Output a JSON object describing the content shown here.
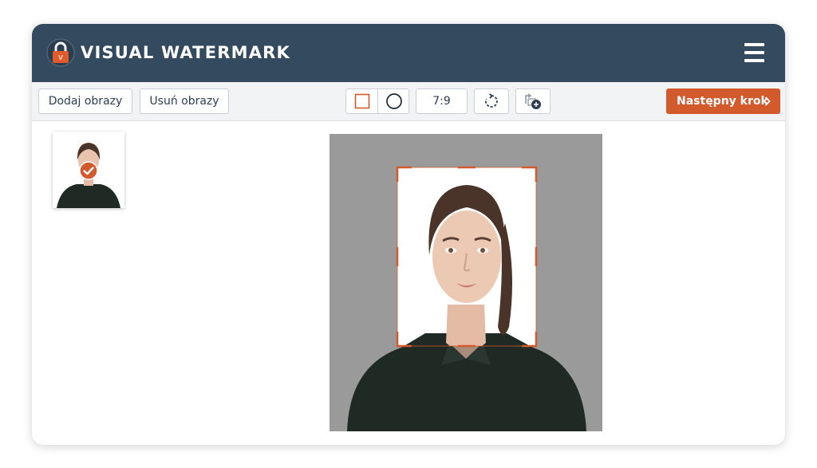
{
  "header": {
    "brand": "VISUAL WATERMARK",
    "logo_icon": "padlock-logo-icon",
    "menu_icon": "hamburger-menu-icon",
    "background": "#344a5f"
  },
  "toolbar": {
    "add_images_label": "Dodaj obrazy",
    "remove_images_label": "Usuń obrazy",
    "shape_square_icon": "square-crop-icon",
    "shape_circle_icon": "circle-crop-icon",
    "aspect_ratio": "7:9",
    "rotate_icon": "rotate-icon",
    "rotate_images_icon": "rotate-images-icon",
    "next_step_label": "Następny krok",
    "accent_color": "#d35a2c"
  },
  "thumbnails": [
    {
      "name": "portrait-thumbnail",
      "selected": true,
      "check_icon": "check-badge-icon"
    }
  ]
}
